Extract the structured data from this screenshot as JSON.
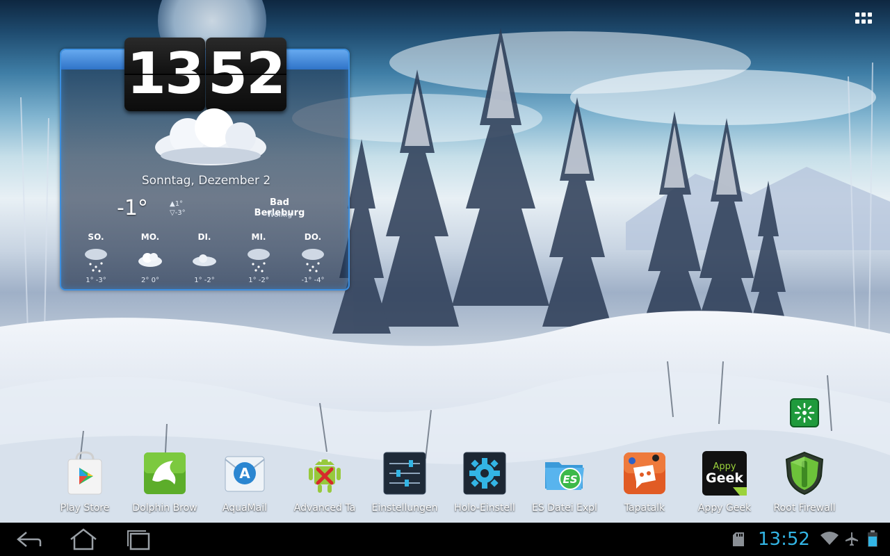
{
  "clock": {
    "hours": "13",
    "minutes": "52"
  },
  "weather": {
    "date": "Sonntag, Dezember 2",
    "temperature": "-1°",
    "high": "▲1°",
    "low": "▽-3°",
    "city": "Bad Berleburg",
    "condition": "Wolkig",
    "forecast": [
      {
        "day": "SO.",
        "range": "1° -3°",
        "icon": "snow-icon"
      },
      {
        "day": "MO.",
        "range": "2° 0°",
        "icon": "cloud-icon"
      },
      {
        "day": "DI.",
        "range": "1° -2°",
        "icon": "cloud-icon"
      },
      {
        "day": "MI.",
        "range": "1° -2°",
        "icon": "snow-icon"
      },
      {
        "day": "DO.",
        "range": "-1° -4°",
        "icon": "snow-icon"
      }
    ]
  },
  "dock": [
    {
      "label": "Play Store",
      "icon": "play-store-icon"
    },
    {
      "label": "Dolphin Brow",
      "icon": "dolphin-icon"
    },
    {
      "label": "AquaMail",
      "icon": "aquamail-icon"
    },
    {
      "label": "Advanced Ta",
      "icon": "android-task-killer-icon"
    },
    {
      "label": "Einstellungen",
      "icon": "settings-sliders-icon"
    },
    {
      "label": "Holo-Einstell",
      "icon": "holo-gear-icon"
    },
    {
      "label": "ES Datei Expl",
      "icon": "es-file-explorer-icon"
    },
    {
      "label": "Tapatalk",
      "icon": "tapatalk-icon"
    },
    {
      "label": "Appy Geek",
      "icon": "appy-geek-icon",
      "icon_text": "Appy Geek"
    },
    {
      "label": "Root Firewall",
      "icon": "root-firewall-icon"
    }
  ],
  "status_bar": {
    "time": "13:52",
    "icons": [
      "sd-card-icon",
      "wifi-icon",
      "airplane-icon",
      "battery-icon"
    ]
  },
  "colors": {
    "clock_accent": "#33b5e5",
    "widget_border": "#3c8fe0"
  }
}
